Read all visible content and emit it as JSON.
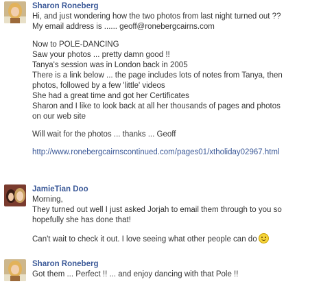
{
  "posts": [
    {
      "author": "Sharon Roneberg",
      "lines": [
        "Hi, and just wondering how the two photos from last night turned out ??",
        "My email address is ...... geoff@ronebergcairns.com",
        "",
        "Now to POLE-DANCING",
        "Saw your photos ... pretty damn good !!",
        "Tanya's session was in London back in 2005",
        "There is a link below ... the page includes lots of notes from Tanya, then",
        "photos, followed by a few 'little' videos",
        "She had a great time and got her Certificates",
        "Sharon and I like to look back at all her thousands of pages and photos",
        "on our web site",
        "",
        "Will wait for the photos ... thanks ... Geoff"
      ],
      "link": "http://www.ronebergcairnscontinued.com/pages01/xtholiday02967.html"
    },
    {
      "author": "JamieTian Doo",
      "lines": [
        "Morning,",
        "They turned out well I just asked Jorjah to email them through to you so",
        "hopefully she has done that!",
        "",
        "Can't wait to check it out. I love seeing what other people can do"
      ]
    },
    {
      "author": "Sharon Roneberg",
      "lines": [
        "Got them ... Perfect !! ... and enjoy dancing with that Pole !!"
      ]
    }
  ],
  "icons": {
    "smiley": "smiley-emoticon-icon"
  },
  "colors": {
    "author_link": "#3b5998",
    "text": "#333333"
  }
}
